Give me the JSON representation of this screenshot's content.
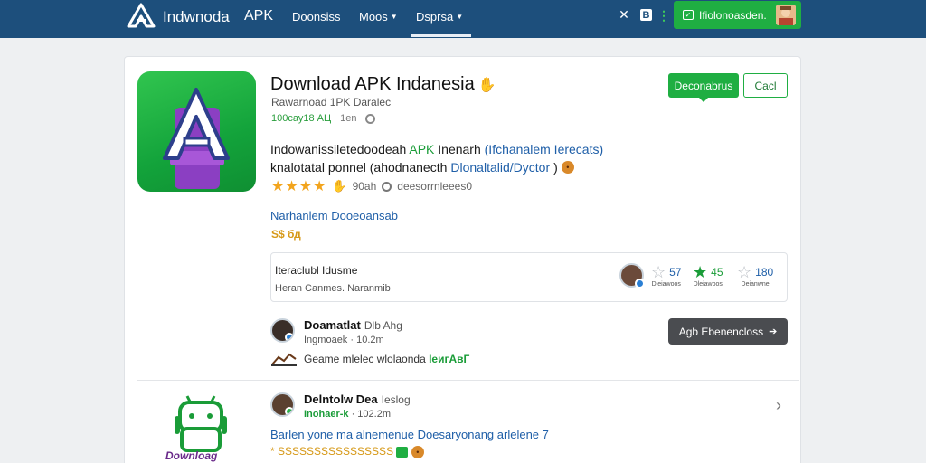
{
  "header": {
    "brand": "Indwnoda",
    "brand_suffix": "APK",
    "nav": [
      {
        "label": "Doonsiss"
      },
      {
        "label": "Moos"
      },
      {
        "label": "Dsprsa"
      }
    ],
    "account_button": "Ifiolonoasden."
  },
  "app": {
    "title": "Download APK Indanesia",
    "subtitle": "Rawarnoad 1PK Daralec",
    "meta_left": "100сау18 АЦ",
    "meta_right": "1en",
    "desc_line1_a": "Indowanissiletedoodeah",
    "desc_line1_green": "APK",
    "desc_line1_b": "Inenarh",
    "desc_line1_blue": "(Ifchanalem Ierecats)",
    "desc_line2_a": "knalotatal ponnel (ahodnanecth",
    "desc_line2_blue": "Dlonaltalid/Dyctor",
    "desc_line2_b": ")",
    "rating_count": "90ah",
    "rating_label": "deesorrnleees0",
    "section_link": "Narhanlem Dooeoansab",
    "price": "S$ бд",
    "btn_primary": "Deconabrus",
    "btn_secondary": "Cacl"
  },
  "reviews_box": {
    "line1": "Iteraclubl Idusme",
    "line2": "Heran Canmes. Naranmib",
    "stats": [
      {
        "value": "57",
        "label": "Dleiawoos"
      },
      {
        "value": "45",
        "label": "Dleiawoos"
      },
      {
        "value": "180",
        "label": "Deianwne"
      }
    ]
  },
  "comment1": {
    "name": "Doamatlat",
    "name_extra": "Dlb Ahg",
    "sub": "Ingmoaek · 10.2m",
    "text": "Geame mlelec wlolaonda",
    "text_green": "IеигАвГ",
    "action": "Agb Ebenencloss"
  },
  "comment2": {
    "name": "Delntolw Dea",
    "name_extra": "Ieslog",
    "sub_green": "Inohaer-k",
    "sub": "· 102.2m",
    "text": "Barlen yone ma alnemenue Doesaryonang arlelene 7",
    "text2": "* SSSSSSSSSSSSSSSS",
    "download_label": "Downloag"
  },
  "colors": {
    "header_bg": "#1d4f7c",
    "accent_green": "#1fae42",
    "link_blue": "#1f5fa8",
    "star_gold": "#f2a41d"
  }
}
